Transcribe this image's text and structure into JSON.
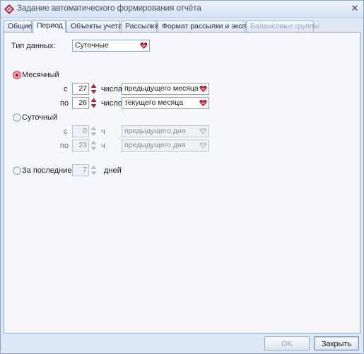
{
  "window": {
    "title": "Задание автоматического формирования отчёта",
    "close_glyph": "✕"
  },
  "tabs": [
    {
      "label": "Общие",
      "state": "normal"
    },
    {
      "label": "Период",
      "state": "active"
    },
    {
      "label": "Объекты учета",
      "state": "normal"
    },
    {
      "label": "Рассылка",
      "state": "normal"
    },
    {
      "label": "Формат рассылки и экспорта",
      "state": "normal"
    },
    {
      "label": "Балансовые группы",
      "state": "disabled"
    }
  ],
  "data_type": {
    "label": "Тип данных:",
    "value": "Суточные"
  },
  "monthly": {
    "label": "Месячный",
    "selected": true,
    "from_label": "с",
    "from_day": "27",
    "from_unit": "числа",
    "from_month": "предыдущего месяца",
    "to_label": "по",
    "to_day": "26",
    "to_unit": "число",
    "to_month": "текущего месяца"
  },
  "daily": {
    "label": "Суточный",
    "selected": false,
    "from_label": "с",
    "from_hour": "0",
    "from_unit": "ч",
    "from_day": "предыдущего дня",
    "to_label": "по",
    "to_hour": "23",
    "to_unit": "ч",
    "to_day": "предыдущего дня"
  },
  "last": {
    "label": "За последние",
    "value": "7",
    "unit": "дней",
    "selected": false
  },
  "footer": {
    "ok_label": "OK",
    "close_label": "Закрыть"
  },
  "colors": {
    "accent_red": "#c4172c",
    "border": "#8fa6c6"
  },
  "icons": {
    "app": "app-diamond-icon",
    "dropdown": "heart-dropdown-icon",
    "spin": "spin-arrows-icon"
  }
}
